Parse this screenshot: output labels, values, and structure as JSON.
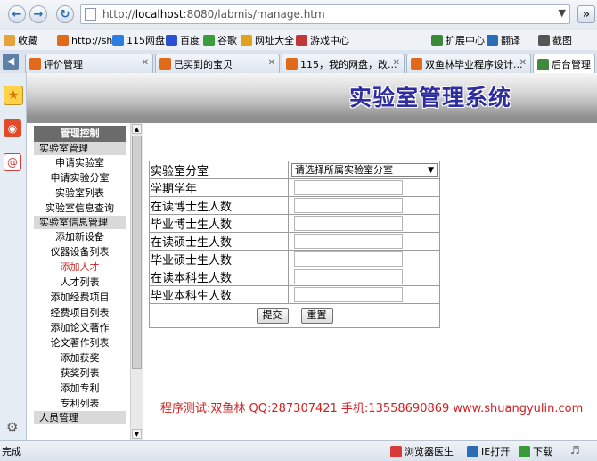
{
  "browser": {
    "url_prefix": "http://",
    "url_host": "localhost",
    "url_rest": ":8080/labmis/manage.htm"
  },
  "bookmarks": [
    {
      "label": "收藏",
      "color": "#e8a23a",
      "icon": "star-icon"
    },
    {
      "label": "http://sh",
      "color": "#e06a1a",
      "icon": "page-icon"
    },
    {
      "label": "115网盘",
      "color": "#2b7de0",
      "icon": "cloud-icon"
    },
    {
      "label": "百度",
      "color": "#2c4fd6",
      "icon": "paw-icon"
    },
    {
      "label": "谷歌",
      "color": "#3a9c3a",
      "icon": "google-icon"
    },
    {
      "label": "网址大全",
      "color": "#e0a020",
      "icon": "globe-icon"
    },
    {
      "label": "游戏中心",
      "color": "#c03838",
      "icon": "game-icon"
    }
  ],
  "tools": [
    {
      "label": "扩展中心",
      "color": "#3a8a3a",
      "icon": "puzzle-icon"
    },
    {
      "label": "翻译",
      "color": "#2b6db5",
      "icon": "translate-icon"
    },
    {
      "label": "截图",
      "color": "#555555",
      "icon": "scissors-icon"
    }
  ],
  "tabs": [
    {
      "label": "评价管理",
      "active": false
    },
    {
      "label": "已买到的宝贝",
      "active": false
    },
    {
      "label": "115，我的网盘，改...",
      "active": false
    },
    {
      "label": "双鱼林毕业程序设计...",
      "active": false
    },
    {
      "label": "后台管理",
      "active": true
    }
  ],
  "header": {
    "title": "实验室管理系统"
  },
  "menu": {
    "title": "管理控制",
    "sections": [
      {
        "title": "实验室管理",
        "items": [
          {
            "label": "申请实验室",
            "active": false
          },
          {
            "label": "申请实验分室",
            "active": false
          },
          {
            "label": "实验室列表",
            "active": false
          },
          {
            "label": "实验室信息查询",
            "active": false
          }
        ]
      },
      {
        "title": "实验室信息管理",
        "items": [
          {
            "label": "添加新设备",
            "active": false
          },
          {
            "label": "仪器设备列表",
            "active": false
          },
          {
            "label": "添加人才",
            "active": true
          },
          {
            "label": "人才列表",
            "active": false
          },
          {
            "label": "添加经费项目",
            "active": false
          },
          {
            "label": "经费项目列表",
            "active": false
          },
          {
            "label": "添加论文著作",
            "active": false
          },
          {
            "label": "论文著作列表",
            "active": false
          },
          {
            "label": "添加获奖",
            "active": false
          },
          {
            "label": "获奖列表",
            "active": false
          },
          {
            "label": "添加专利",
            "active": false
          },
          {
            "label": "专利列表",
            "active": false
          }
        ]
      },
      {
        "title": "人员管理",
        "items": []
      }
    ]
  },
  "form": {
    "lab_label": "实验室分室",
    "lab_select": "请选择所属实验室分室",
    "fields": [
      {
        "label": "学期学年",
        "value": ""
      },
      {
        "label": "在读博士生人数",
        "value": ""
      },
      {
        "label": "毕业博士生人数",
        "value": ""
      },
      {
        "label": "在读硕士生人数",
        "value": ""
      },
      {
        "label": "毕业硕士生人数",
        "value": ""
      },
      {
        "label": "在读本科生人数",
        "value": ""
      },
      {
        "label": "毕业本科生人数",
        "value": ""
      }
    ],
    "submit": "提交",
    "reset": "重置"
  },
  "footer": "程序测试:双鱼林 QQ:287307421 手机:13558690869 www.shuangyulin.com",
  "status": {
    "left": "完成",
    "doctor": "浏览器医生",
    "ie_open": "IE打开",
    "download": "下载"
  }
}
